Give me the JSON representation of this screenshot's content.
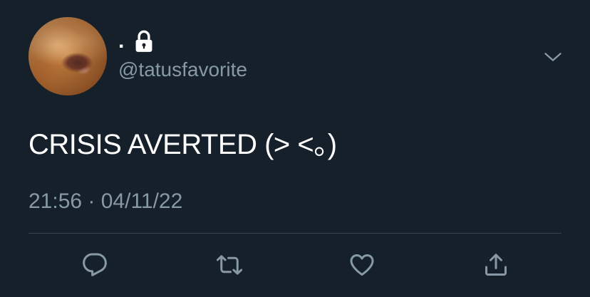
{
  "tweet": {
    "display_name": ".",
    "handle": "@tatusfavorite",
    "text": "CRISIS AVERTED (> <。)",
    "timestamp": "21:56 · 04/11/22",
    "protected": true
  },
  "icons": {
    "lock": "lock-icon",
    "menu": "chevron-down-icon",
    "reply": "reply-icon",
    "retweet": "retweet-icon",
    "like": "heart-icon",
    "share": "share-icon"
  },
  "colors": {
    "background": "#15202b",
    "primary_text": "#ffffff",
    "secondary_text": "#8899a6",
    "divider": "#38444d"
  }
}
